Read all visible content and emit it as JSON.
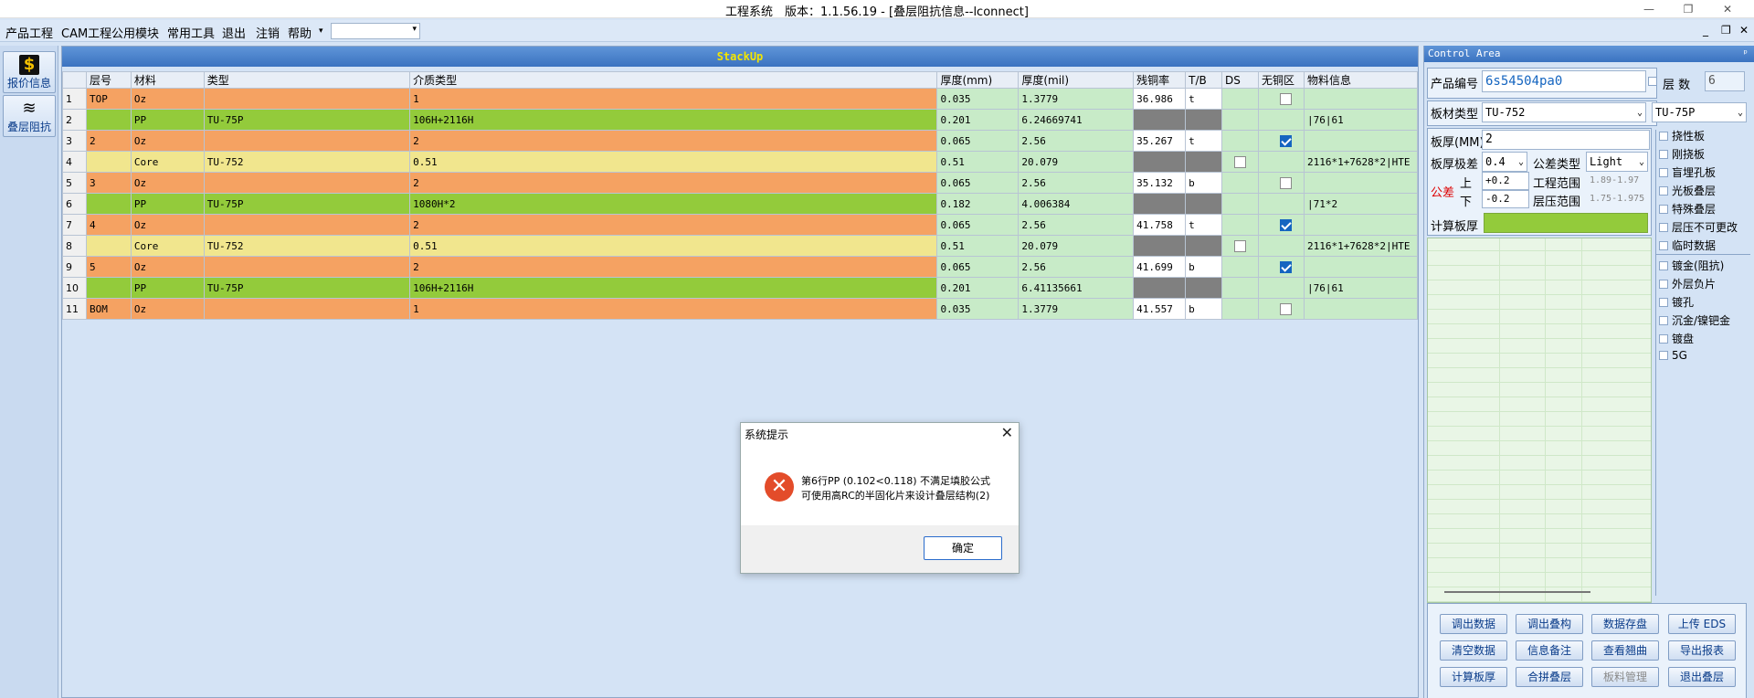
{
  "window": {
    "title": "工程系统　版本：1.1.56.19 - [叠层阻抗信息--lconnect]",
    "controls": [
      "—",
      "❐",
      "✕"
    ]
  },
  "menu": {
    "items": [
      "产品工程",
      "CAM工程",
      "公用模块",
      "常用工具",
      "退出",
      "注销",
      "帮助"
    ],
    "dropdown_arrow": "▾",
    "right_controls": [
      "_",
      "❐",
      "✕"
    ]
  },
  "sidebar": {
    "items": [
      {
        "label": "报价信息",
        "icon": "dollar-icon",
        "glyph": "$"
      },
      {
        "label": "叠层阻抗",
        "icon": "layers-icon",
        "glyph": "≋"
      }
    ]
  },
  "stackup": {
    "title": "StackUp",
    "columns": [
      "层号",
      "材料",
      "类型",
      "介质类型",
      "厚度(mm)",
      "厚度(mil)",
      "残铜率",
      "T/B",
      "DS",
      "无铜区",
      "物料信息"
    ],
    "rows": [
      {
        "n": "1",
        "layer": "TOP",
        "mat": "Oz",
        "type": "",
        "dielectric": "1",
        "mm": "0.035",
        "mil": "1.3779",
        "cu": "36.986",
        "tb": "t",
        "ds": "",
        "nocu": "off",
        "info": "",
        "kind": "cu"
      },
      {
        "n": "2",
        "layer": "",
        "mat": "PP",
        "type": "TU-75P",
        "dielectric": "106H+2116H",
        "mm": "0.201",
        "mil": "6.24669741",
        "cu": "",
        "tb": "",
        "ds": "",
        "nocu": "",
        "info": "|76|61",
        "kind": "pp"
      },
      {
        "n": "3",
        "layer": "2",
        "mat": "Oz",
        "type": "",
        "dielectric": "2",
        "mm": "0.065",
        "mil": "2.56",
        "cu": "35.267",
        "tb": "t",
        "ds": "",
        "nocu": "on",
        "info": "",
        "kind": "cu"
      },
      {
        "n": "4",
        "layer": "",
        "mat": "Core",
        "type": "TU-752",
        "dielectric": "0.51",
        "mm": "0.51",
        "mil": "20.079",
        "cu": "",
        "tb": "",
        "ds": "off",
        "nocu": "",
        "info": "2116*1+7628*2|HTE",
        "kind": "core"
      },
      {
        "n": "5",
        "layer": "3",
        "mat": "Oz",
        "type": "",
        "dielectric": "2",
        "mm": "0.065",
        "mil": "2.56",
        "cu": "35.132",
        "tb": "b",
        "ds": "",
        "nocu": "off",
        "info": "",
        "kind": "cu"
      },
      {
        "n": "6",
        "layer": "",
        "mat": "PP",
        "type": "TU-75P",
        "dielectric": "1080H*2",
        "mm": "0.182",
        "mil": "4.006384",
        "cu": "",
        "tb": "",
        "ds": "",
        "nocu": "",
        "info": "|71*2",
        "kind": "pp"
      },
      {
        "n": "7",
        "layer": "4",
        "mat": "Oz",
        "type": "",
        "dielectric": "2",
        "mm": "0.065",
        "mil": "2.56",
        "cu": "41.758",
        "tb": "t",
        "ds": "",
        "nocu": "on",
        "info": "",
        "kind": "cu"
      },
      {
        "n": "8",
        "layer": "",
        "mat": "Core",
        "type": "TU-752",
        "dielectric": "0.51",
        "mm": "0.51",
        "mil": "20.079",
        "cu": "",
        "tb": "",
        "ds": "off",
        "nocu": "",
        "info": "2116*1+7628*2|HTE",
        "kind": "core"
      },
      {
        "n": "9",
        "layer": "5",
        "mat": "Oz",
        "type": "",
        "dielectric": "2",
        "mm": "0.065",
        "mil": "2.56",
        "cu": "41.699",
        "tb": "b",
        "ds": "",
        "nocu": "on",
        "info": "",
        "kind": "cu"
      },
      {
        "n": "10",
        "layer": "",
        "mat": "PP",
        "type": "TU-75P",
        "dielectric": "106H+2116H",
        "mm": "0.201",
        "mil": "6.41135661",
        "cu": "",
        "tb": "",
        "ds": "",
        "nocu": "",
        "info": "|76|61",
        "kind": "pp"
      },
      {
        "n": "11",
        "layer": "BOM",
        "mat": "Oz",
        "type": "",
        "dielectric": "1",
        "mm": "0.035",
        "mil": "1.3779",
        "cu": "41.557",
        "tb": "b",
        "ds": "",
        "nocu": "off",
        "info": "",
        "kind": "cu"
      }
    ]
  },
  "dialog": {
    "title": "系统提示",
    "line1": "第6行PP (0.102<0.118) 不满足填胶公式",
    "line2": "可使用高RC的半固化片来设计叠层结构(2)",
    "ok": "确定",
    "close": "✕",
    "icon_glyph": "✕"
  },
  "control": {
    "title": "Control Area",
    "pin": "ᵖ",
    "product_no_label": "产品编号",
    "product_no": "6s54504pa0",
    "layer_count_label": "层 数",
    "layer_count": "6",
    "board_type_label": "板材类型",
    "board_type": "TU-752",
    "board_type2": "TU-75P",
    "thickness_label": "板厚(MM)",
    "thickness": "2",
    "thk_diff_label": "板厚极差",
    "thk_diff": "0.4",
    "tol_type_label": "公差类型",
    "tol_type": "Light",
    "tol_label": "公差",
    "up_label": "上",
    "up": "+0.2",
    "down_label": "下",
    "down": "-0.2",
    "eng_range_label": "工程范围",
    "eng_range": "1.89-1.97",
    "press_range_label": "层压范围",
    "press_range": "1.75-1.975",
    "calc_thk_label": "计算板厚",
    "options": [
      "挠性板",
      "刚挠板",
      "盲埋孔板",
      "光板叠层",
      "特殊叠层",
      "层压不可更改",
      "临时数据",
      "镀金(阻抗)",
      "外层负片",
      "镀孔",
      "沉金/镍钯金",
      "镀盘",
      "5G"
    ],
    "buttons": [
      {
        "label": "调出数据",
        "enabled": true
      },
      {
        "label": "调出叠构",
        "enabled": true
      },
      {
        "label": "数据存盘",
        "enabled": true
      },
      {
        "label": "上传 EDS",
        "enabled": true
      },
      {
        "label": "清空数据",
        "enabled": true
      },
      {
        "label": "信息备注",
        "enabled": true
      },
      {
        "label": "查看翘曲",
        "enabled": true
      },
      {
        "label": "导出报表",
        "enabled": true
      },
      {
        "label": "计算板厚",
        "enabled": true
      },
      {
        "label": "合拼叠层",
        "enabled": true
      },
      {
        "label": "板料管理",
        "enabled": false
      },
      {
        "label": "退出叠层",
        "enabled": true
      }
    ]
  },
  "colors": {
    "copper": "#f5a262",
    "pp": "#93cb3b",
    "core": "#f1e68e",
    "cell_light": "#c8ebc8",
    "cell_gray": "#808080",
    "title_accent": "#f3e600",
    "calc_bar": "#93cb3b"
  }
}
